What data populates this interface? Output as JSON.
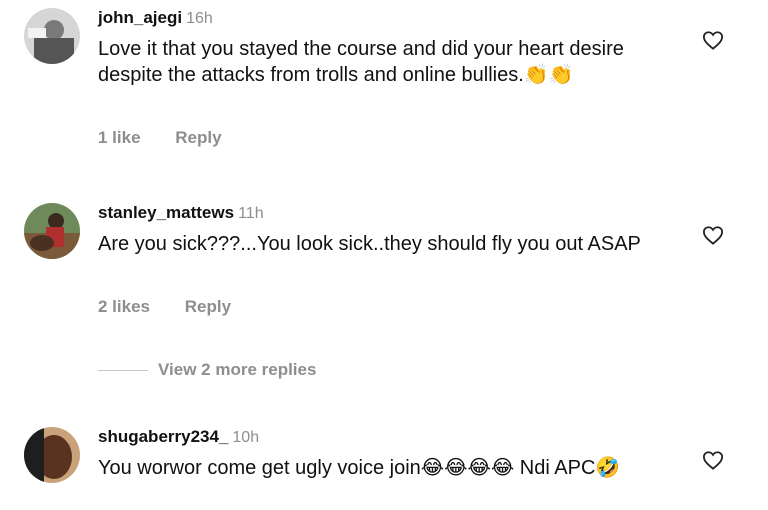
{
  "comments": [
    {
      "username": "john_ajegi",
      "time": "16h",
      "text": "Love it that you stayed the course and did your heart desire despite the attacks from trolls and online bullies.👏👏",
      "likes": "1 like",
      "reply": "Reply"
    },
    {
      "username": "stanley_mattews",
      "time": "11h",
      "text": "Are you sick???...You look sick..they should fly you out ASAP",
      "likes": "2 likes",
      "reply": "Reply"
    },
    {
      "username": "shugaberry234_",
      "time": "10h",
      "text": "You worwor come get ugly voice join😂😂😂😂 Ndi APC🤣"
    }
  ],
  "view_more": "View 2 more replies",
  "colors": {
    "secondary": "#8e8e8e",
    "text": "#111111"
  }
}
